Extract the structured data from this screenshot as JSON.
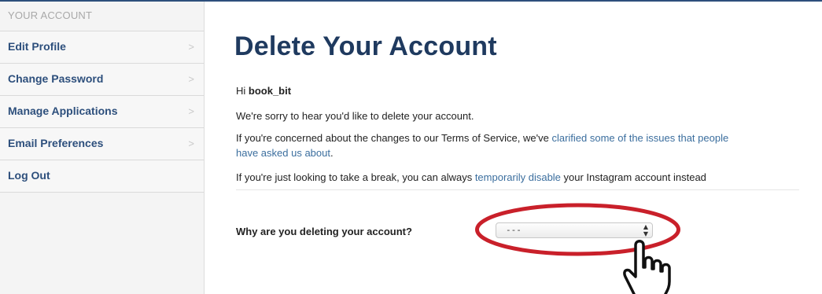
{
  "sidebar": {
    "header": "YOUR ACCOUNT",
    "items": [
      {
        "label": "Edit Profile",
        "chevron": ">"
      },
      {
        "label": "Change Password",
        "chevron": ">"
      },
      {
        "label": "Manage Applications",
        "chevron": ">"
      },
      {
        "label": "Email Preferences",
        "chevron": ">"
      },
      {
        "label": "Log Out"
      }
    ]
  },
  "main": {
    "title": "Delete Your Account",
    "greeting_prefix": "Hi ",
    "username": "book_bit",
    "sorry_text": "We're sorry to hear you'd like to delete your account.",
    "concerned_prefix": "If you're concerned about the changes to our Terms of Service, we've ",
    "concerned_link": "clarified some of the issues that people",
    "concerned_link_line2": "have asked us about",
    "concerned_suffix": ".",
    "break_prefix": "If you're just looking to take a break, you can always ",
    "break_link": "temporarily disable",
    "break_suffix": " your Instagram account instead",
    "question": "Why are you deleting your account?",
    "select_value": "---",
    "select_arrows": "▲▼"
  },
  "annotation": {
    "ellipse_color": "#c9202a",
    "icon": "pointing-hand-icon"
  },
  "colors": {
    "brand": "#1f3a5f",
    "link": "#3b6e9e",
    "nav": "#2d4f7c"
  }
}
